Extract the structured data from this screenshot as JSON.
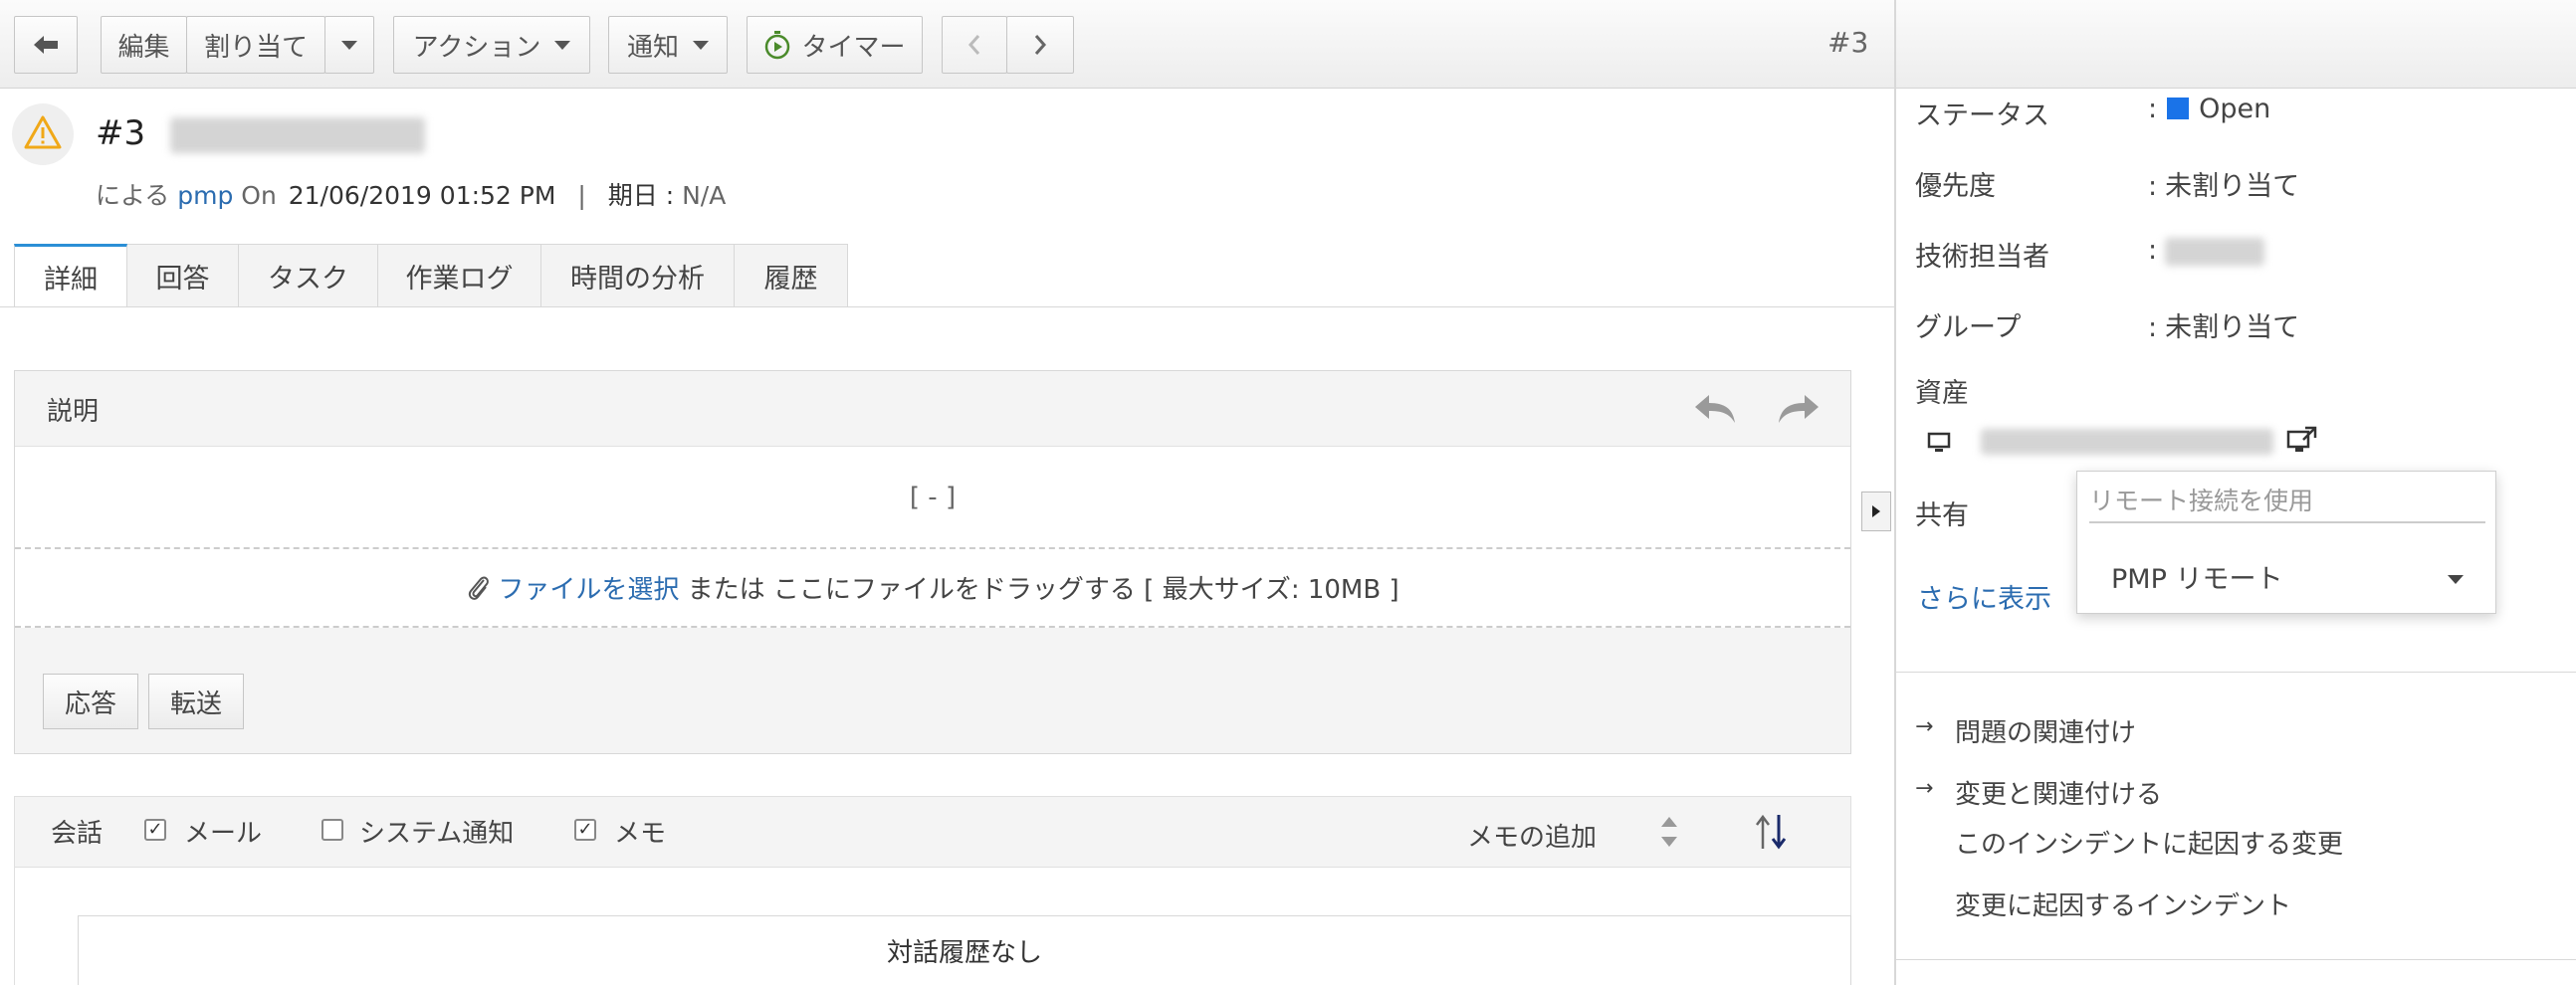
{
  "toolbar": {
    "edit_label": "編集",
    "assign_label": "割り当て",
    "actions_label": "アクション",
    "notify_label": "通知",
    "timer_label": "タイマー",
    "ticket_number": "#3"
  },
  "header": {
    "ticket_no": "#3",
    "by_label": "による",
    "requester": "pmp",
    "on_label": "On",
    "created": "21/06/2019 01:52 PM",
    "separator": "|",
    "due_label": "期日 :",
    "due_value": "N/A"
  },
  "tabs": [
    {
      "label": "詳細"
    },
    {
      "label": "回答"
    },
    {
      "label": "タスク"
    },
    {
      "label": "作業ログ"
    },
    {
      "label": "時間の分析"
    },
    {
      "label": "履歴"
    }
  ],
  "description": {
    "title": "説明",
    "body": "[ - ]",
    "attach_link": "ファイルを選択",
    "attach_text": " または ここにファイルをドラッグする [ 最大サイズ: 10MB ]",
    "reply_label": "応答",
    "forward_label": "転送"
  },
  "conversation": {
    "label": "会話",
    "mail_label": "メール",
    "system_label": "システム通知",
    "memo_label": "メモ",
    "add_memo": "メモの追加",
    "empty_text": "対話履歴なし",
    "mail_checked": true,
    "system_checked": false,
    "memo_checked": true
  },
  "properties": {
    "status_label": "ステータス",
    "status_value": "Open",
    "status_color": "#1a73e8",
    "priority_label": "優先度",
    "priority_value": "未割り当て",
    "tech_label": "技術担当者",
    "group_label": "グループ",
    "group_value": "未割り当て",
    "asset_label": "資産",
    "shared_label": "共有",
    "more_label": "さらに表示",
    "colon": ":"
  },
  "remote_popup": {
    "placeholder": "リモート接続を使用",
    "selected": "PMP リモート"
  },
  "related": {
    "link_problem": "問題の関連付け",
    "link_change": "変更と関連付ける",
    "change_from_incident": "このインシデントに起因する変更",
    "incident_from_change": "変更に起因するインシデント"
  }
}
